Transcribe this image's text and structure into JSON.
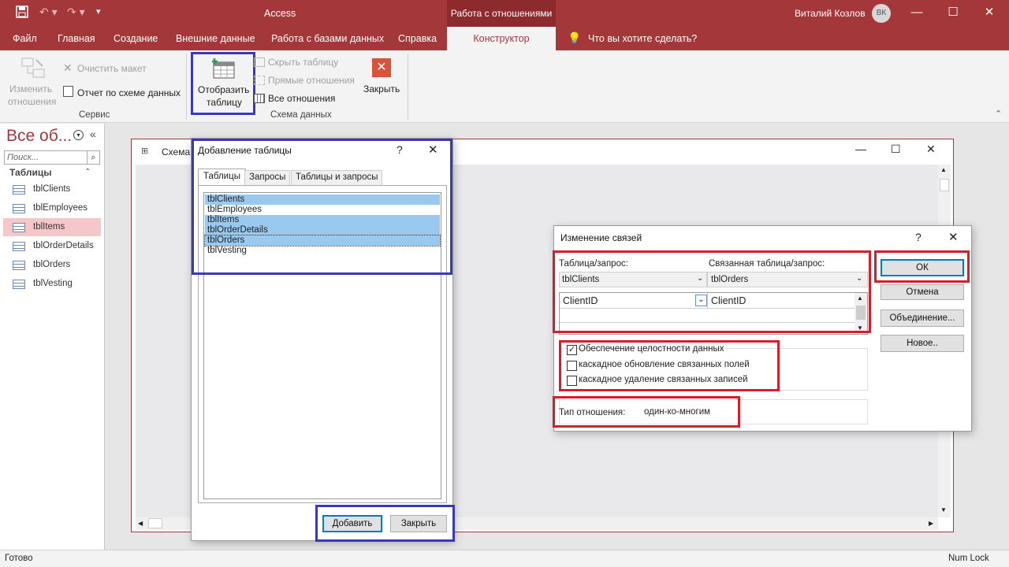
{
  "titlebar": {
    "app_name": "Access",
    "context_tab_title": "Работа с отношениями",
    "user_name": "Виталий Козлов",
    "user_initials": "ВК"
  },
  "tabs": [
    "Файл",
    "Главная",
    "Создание",
    "Внешние данные",
    "Работа с базами данных",
    "Справка",
    "Конструктор"
  ],
  "tell_me": "Что вы хотите сделать?",
  "ribbon": {
    "edit_relationships": "Изменить отношения",
    "edit_rel_line1": "Изменить",
    "edit_rel_line2": "отношения",
    "clear_layout": "Очистить макет",
    "relationship_report": "Отчет по схеме данных",
    "group_service": "Сервис",
    "show_table_line1": "Отобразить",
    "show_table_line2": "таблицу",
    "hide_table": "Скрыть таблицу",
    "direct_relationships": "Прямые отношения",
    "all_relationships": "Все отношения",
    "close": "Закрыть",
    "group_schema": "Схема данных"
  },
  "nav": {
    "title": "Все об...",
    "search_placeholder": "Поиск...",
    "section": "Таблицы",
    "items": [
      "tblClients",
      "tblEmployees",
      "tblItems",
      "tblOrderDetails",
      "tblOrders",
      "tblVesting"
    ],
    "selected_index": 2
  },
  "schema_window": {
    "title": "Схема"
  },
  "add_table_dialog": {
    "title": "Добавление таблицы",
    "help": "?",
    "tabs": [
      "Таблицы",
      "Запросы",
      "Таблицы и запросы"
    ],
    "items": [
      "tblClients",
      "tblEmployees",
      "tblItems",
      "tblOrderDetails",
      "tblOrders",
      "tblVesting"
    ],
    "selected": [
      true,
      false,
      true,
      true,
      true,
      false
    ],
    "add_button": "Добавить",
    "close_button": "Закрыть"
  },
  "edit_rel_dialog": {
    "title": "Изменение связей",
    "help": "?",
    "table_label": "Таблица/запрос:",
    "related_label": "Связанная таблица/запрос:",
    "table_value": "tblClients",
    "related_value": "tblOrders",
    "field_left": "ClientID",
    "field_right": "ClientID",
    "ok": "ОК",
    "cancel": "Отмена",
    "join": "Объединение...",
    "new": "Новое..",
    "enforce": "Обеспечение целостности данных",
    "cascade_update": "каскадное обновление связанных полей",
    "cascade_delete": "каскадное удаление связанных записей",
    "enforce_checked": true,
    "cascade_update_checked": false,
    "cascade_delete_checked": false,
    "rel_type_label": "Тип отношения:",
    "rel_type_value": "один-ко-многим"
  },
  "status": {
    "left": "Готово",
    "right": "Num Lock"
  },
  "colors": {
    "accent": "#a4373a",
    "highlight_blue": "#3a3ab8",
    "highlight_red": "#d21f2a",
    "selection": "#99c9ef"
  }
}
